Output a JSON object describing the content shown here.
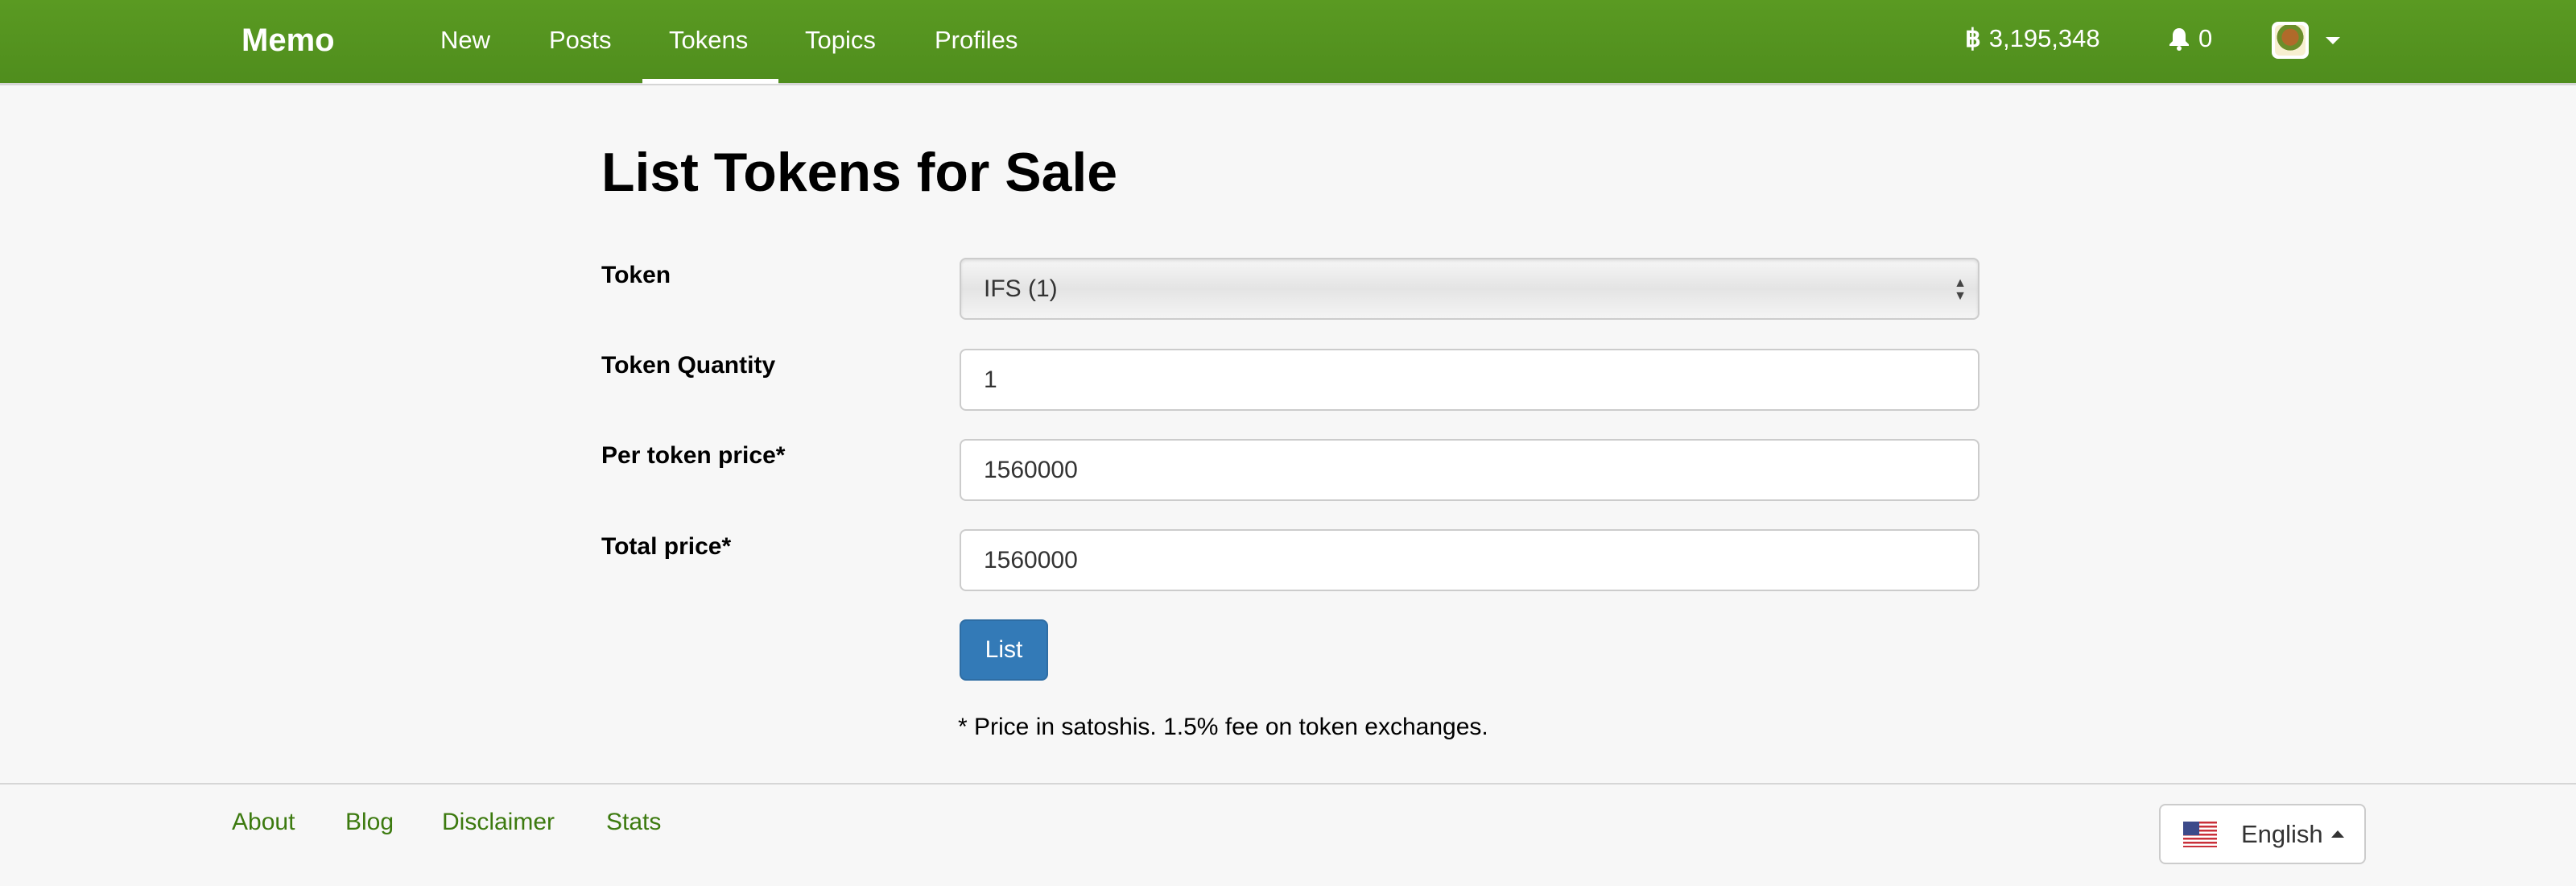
{
  "navbar": {
    "brand": "Memo",
    "items": [
      {
        "label": "New"
      },
      {
        "label": "Posts"
      },
      {
        "label": "Tokens",
        "active": true
      },
      {
        "label": "Topics"
      },
      {
        "label": "Profiles"
      }
    ],
    "balance": "3,195,348",
    "balance_icon": "bitcoin-icon",
    "notifications": "0",
    "notification_icon": "bell-icon"
  },
  "page": {
    "title": "List Tokens for Sale"
  },
  "form": {
    "token_label": "Token",
    "token_value": "IFS (1)",
    "quantity_label": "Token Quantity",
    "quantity_value": "1",
    "per_price_label": "Per token price*",
    "per_price_value": "1560000",
    "total_label": "Total price*",
    "total_value": "1560000",
    "submit": "List",
    "note": "* Price in satoshis. 1.5% fee on token exchanges."
  },
  "footer": {
    "links": [
      "About",
      "Blog",
      "Disclaimer",
      "Stats"
    ],
    "language": "English"
  },
  "colors": {
    "navbar": "#5a9a22",
    "primary_button": "#337ab7",
    "footer_link": "#3c7a0f"
  }
}
